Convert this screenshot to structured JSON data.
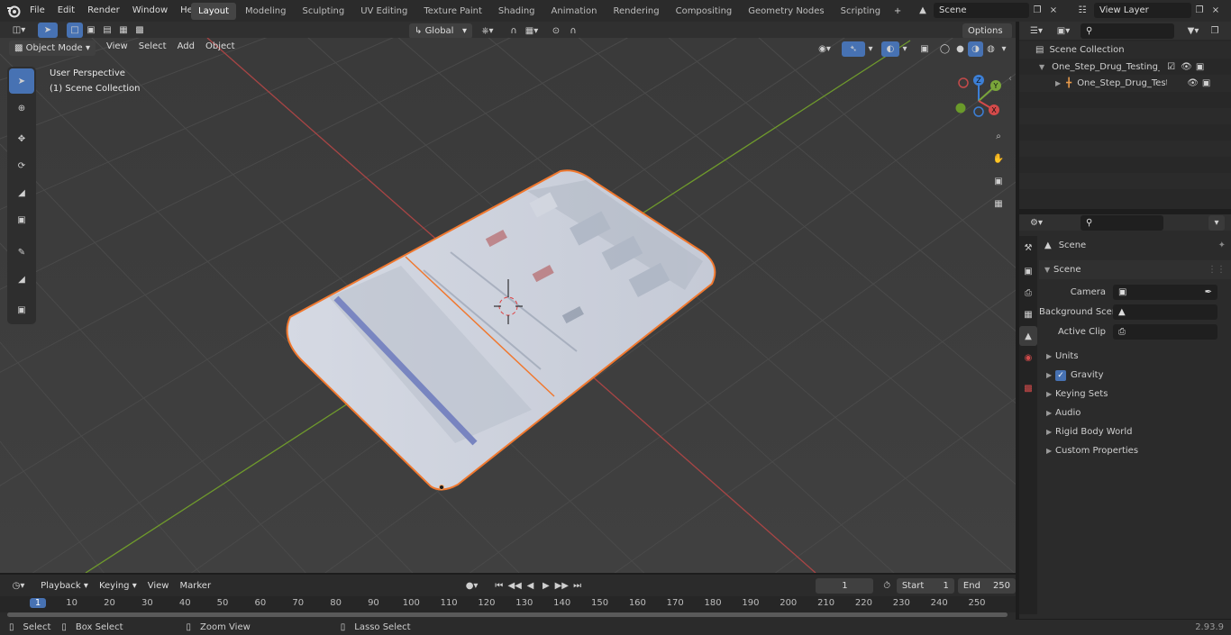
{
  "menu": {
    "file": "File",
    "edit": "Edit",
    "render": "Render",
    "window": "Window",
    "help": "Help"
  },
  "workspace_tabs": [
    {
      "label": "Layout"
    },
    {
      "label": "Modeling"
    },
    {
      "label": "Sculpting"
    },
    {
      "label": "UV Editing"
    },
    {
      "label": "Texture Paint"
    },
    {
      "label": "Shading"
    },
    {
      "label": "Animation"
    },
    {
      "label": "Rendering"
    },
    {
      "label": "Compositing"
    },
    {
      "label": "Geometry Nodes"
    },
    {
      "label": "Scripting"
    }
  ],
  "scene_selector": {
    "value": "Scene"
  },
  "view_layer_selector": {
    "value": "View Layer"
  },
  "viewport_header": {
    "mode": "Object Mode",
    "view": "View",
    "select": "Select",
    "add": "Add",
    "object": "Object",
    "transform_orientation": "Global",
    "options": "Options"
  },
  "viewport_overlay": {
    "perspective": "User Perspective",
    "collection": "(1) Scene Collection"
  },
  "gizmo": {
    "x": "X",
    "y": "Y",
    "z": "Z"
  },
  "outliner": {
    "root": "Scene Collection",
    "items": [
      {
        "label": "One_Step_Drug_Testing_Kit_C"
      },
      {
        "label": "One_Step_Drug_Testing_"
      }
    ]
  },
  "properties": {
    "context": "Scene",
    "section": "Scene",
    "fields": [
      {
        "label": "Camera"
      },
      {
        "label": "Background Scene"
      },
      {
        "label": "Active Clip"
      }
    ],
    "panels": [
      "Units",
      "Gravity",
      "Keying Sets",
      "Audio",
      "Rigid Body World",
      "Custom Properties"
    ],
    "gravity_checked": true
  },
  "timeline": {
    "playback": "Playback",
    "keying": "Keying",
    "view": "View",
    "marker": "Marker",
    "current_frame": "1",
    "start_label": "Start",
    "start": "1",
    "end_label": "End",
    "end": "250",
    "ticks": [
      "1",
      "10",
      "20",
      "30",
      "40",
      "50",
      "60",
      "70",
      "80",
      "90",
      "100",
      "110",
      "120",
      "130",
      "140",
      "150",
      "160",
      "170",
      "180",
      "190",
      "200",
      "210",
      "220",
      "230",
      "240",
      "250"
    ]
  },
  "statusbar": {
    "select": "Select",
    "box_select": "Box Select",
    "zoom_view": "Zoom View",
    "lasso_select": "Lasso Select",
    "version": "2.93.9"
  },
  "colors": {
    "accent": "#4772b3",
    "selection": "#f0782f",
    "x_axis": "#c74747",
    "y_axis": "#6f9a2c",
    "viewport": "#3d3d3d"
  }
}
